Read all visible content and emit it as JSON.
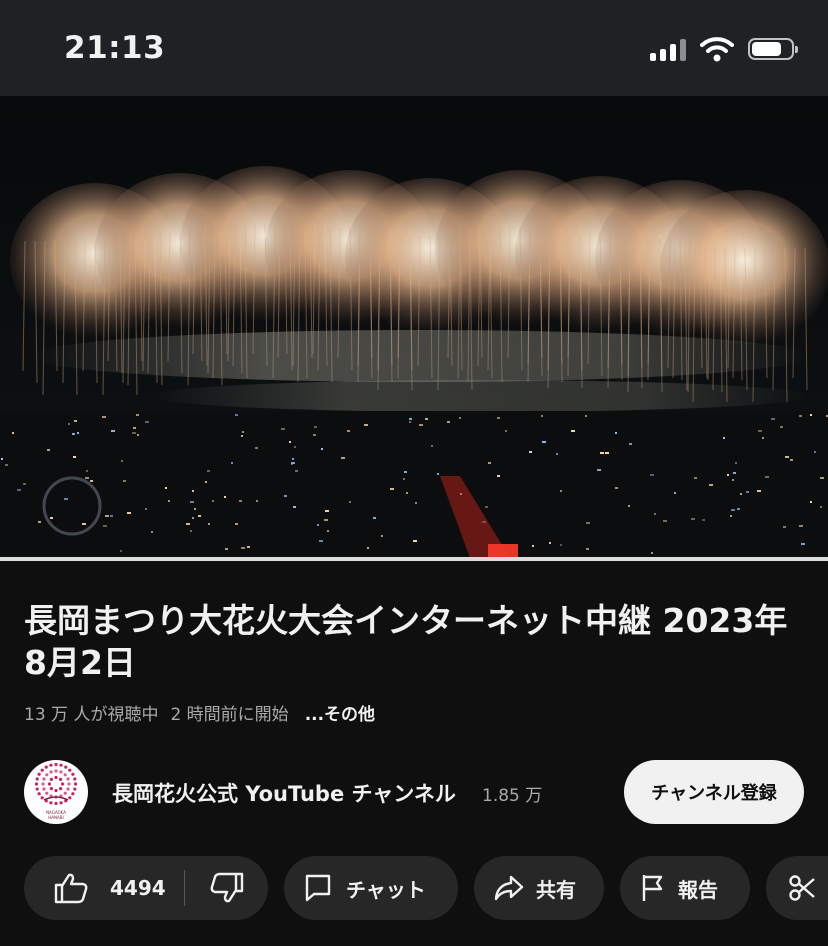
{
  "status_bar": {
    "time": "21:13",
    "battery_level": 0.75
  },
  "video": {
    "progress": 1.0
  },
  "title": "長岡まつり大花火大会インターネット中継 2023年 8月2日",
  "meta": {
    "viewers": "13 万 人が視聴中",
    "started": "2 時間前に開始",
    "more": "...その他"
  },
  "channel": {
    "name": "長岡花火公式 YouTube チャンネル",
    "subscribers": "1.85 万",
    "subscribe_label": "チャンネル登録",
    "avatar_text": "NAGAOKA HANABI"
  },
  "actions": {
    "like_count": "4494",
    "chat_label": "チャット",
    "share_label": "共有",
    "report_label": "報告"
  }
}
